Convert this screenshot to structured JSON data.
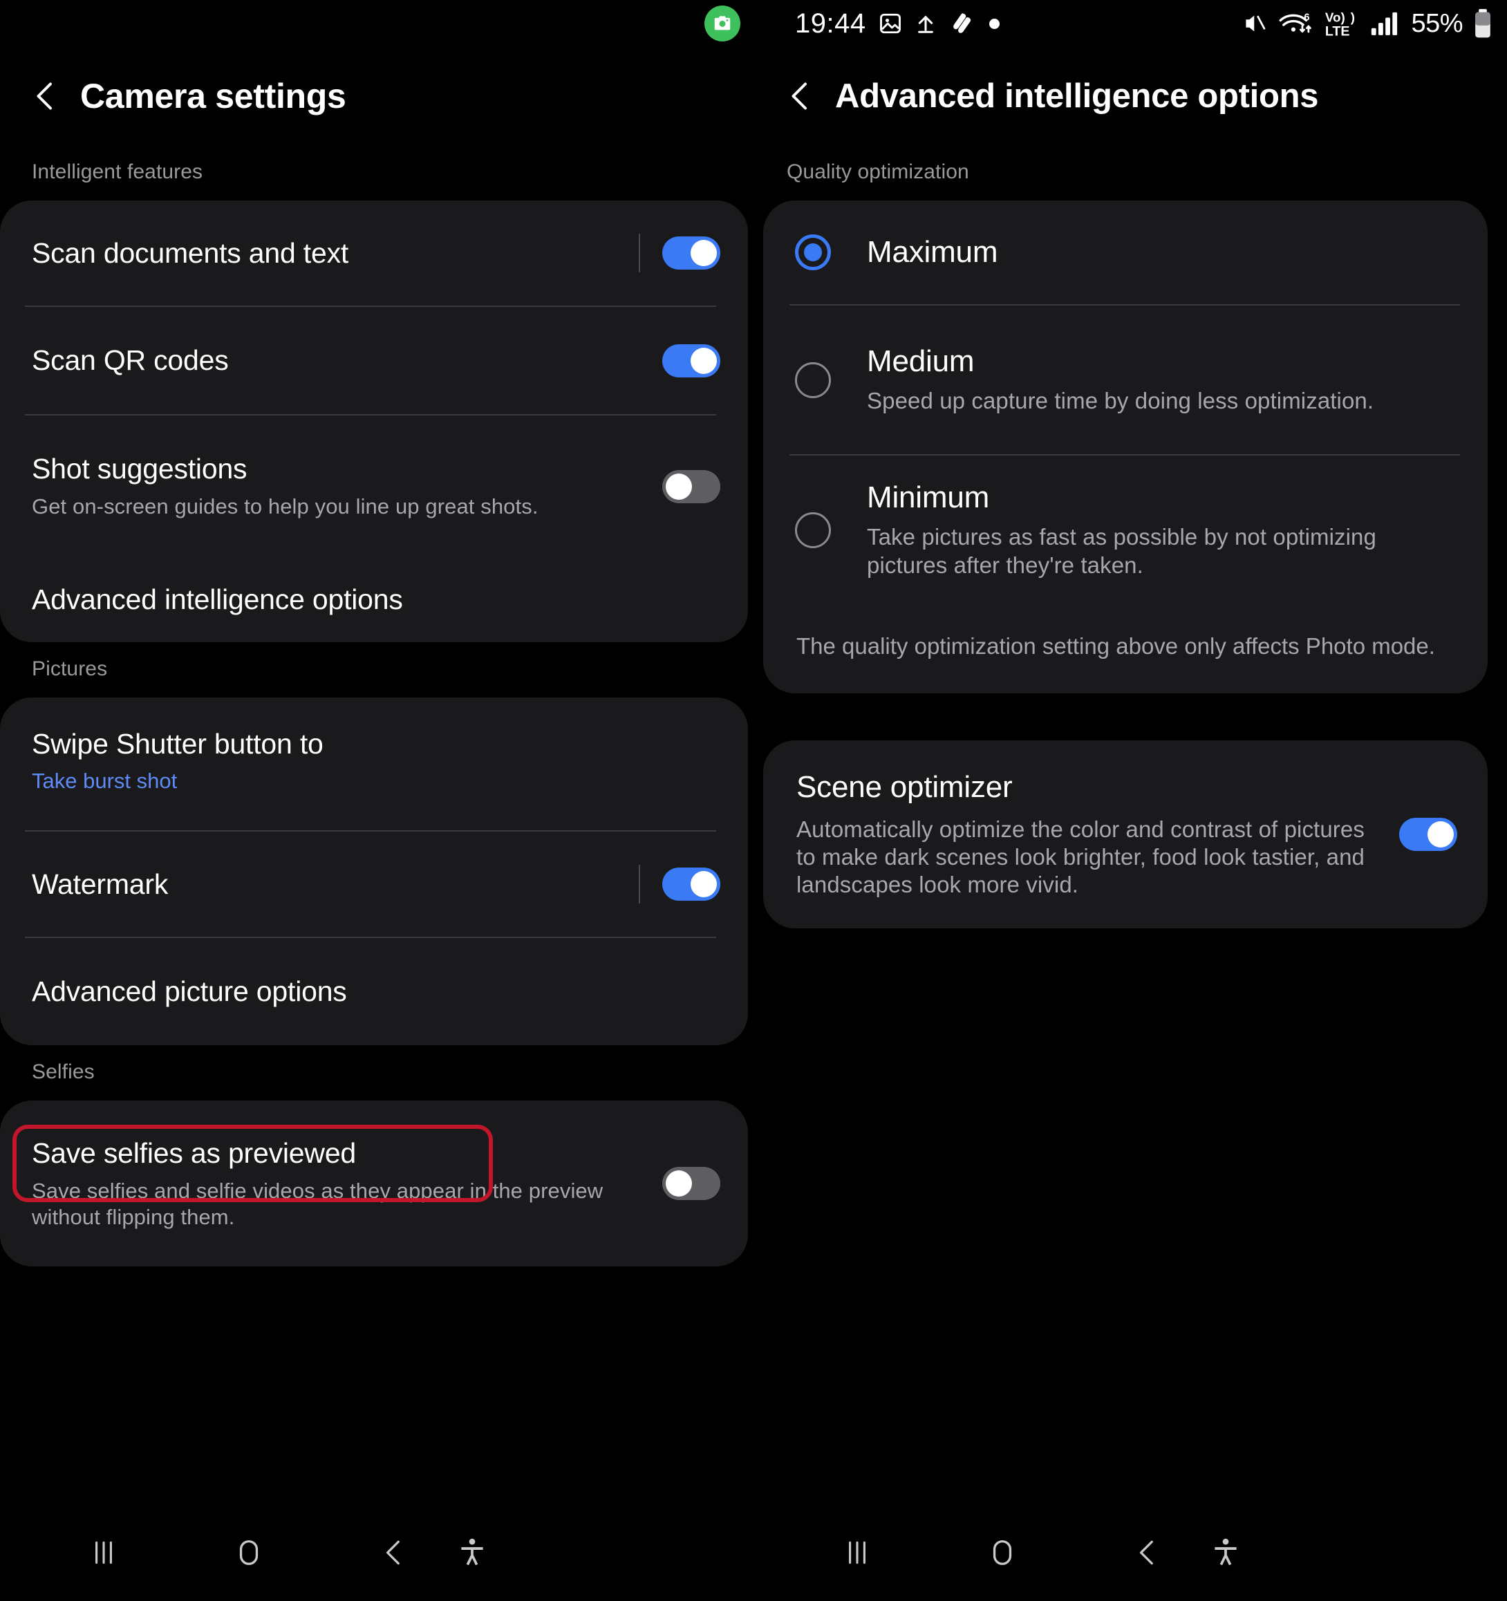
{
  "status_bar": {
    "privacy_icon": "camera-active-icon",
    "time": "19:44",
    "left_icons": [
      "image-icon",
      "upload-icon",
      "swirl-app-icon",
      "dot-icon"
    ],
    "right_icons": [
      "mute-icon",
      "wifi6-icon",
      "volte-icon",
      "signal-bars-icon"
    ],
    "wifi_label": "6",
    "volte_line1": "Vo))",
    "volte_line2": "LTE",
    "battery_percent": "55%",
    "battery_icon": "battery-icon"
  },
  "left_panel": {
    "back_icon": "back-chevron-icon",
    "title": "Camera settings",
    "sections": [
      {
        "header": "Intelligent features",
        "rows": [
          {
            "title": "Scan documents and text",
            "control": "toggle",
            "state": "on",
            "has_separator": true
          },
          {
            "title": "Scan QR codes",
            "control": "toggle",
            "state": "on",
            "has_separator": false
          },
          {
            "title": "Shot suggestions",
            "subtitle": "Get on-screen guides to help you line up great shots.",
            "control": "toggle",
            "state": "off",
            "has_separator": false
          },
          {
            "title": "Advanced intelligence options",
            "control": "none",
            "highlighted": true
          }
        ]
      },
      {
        "header": "Pictures",
        "rows": [
          {
            "title": "Swipe Shutter button to",
            "value": "Take burst shot",
            "control": "none"
          },
          {
            "title": "Watermark",
            "control": "toggle",
            "state": "on",
            "has_separator": true
          },
          {
            "title": "Advanced picture options",
            "control": "none"
          }
        ]
      },
      {
        "header": "Selfies",
        "rows": [
          {
            "title": "Save selfies as previewed",
            "subtitle": "Save selfies and selfie videos as they appear in the preview without flipping them.",
            "control": "toggle",
            "state": "off"
          }
        ]
      }
    ]
  },
  "right_panel": {
    "back_icon": "back-chevron-icon",
    "title": "Advanced intelligence options",
    "quality": {
      "header": "Quality optimization",
      "options": [
        {
          "label": "Maximum",
          "description": "",
          "selected": true
        },
        {
          "label": "Medium",
          "description": "Speed up capture time by doing less optimization.",
          "selected": false
        },
        {
          "label": "Minimum",
          "description": "Take pictures as fast as possible by not optimizing pictures after they're taken.",
          "selected": false
        }
      ],
      "footnote": "The quality optimization setting above only affects Photo mode."
    },
    "scene_optimizer": {
      "title": "Scene optimizer",
      "description": "Automatically optimize the color and contrast of pictures to make dark scenes look brighter, food look tastier, and landscapes look more vivid.",
      "state": "on"
    }
  },
  "nav_bar": {
    "items": [
      "recents-icon",
      "home-icon",
      "back-icon",
      "accessibility-icon"
    ]
  },
  "colors": {
    "accent_blue": "#3b7af5",
    "link_blue": "#5e8bf5",
    "highlight_red": "#c2162b",
    "card_bg": "#1a1a1c",
    "page_bg": "#000000"
  }
}
